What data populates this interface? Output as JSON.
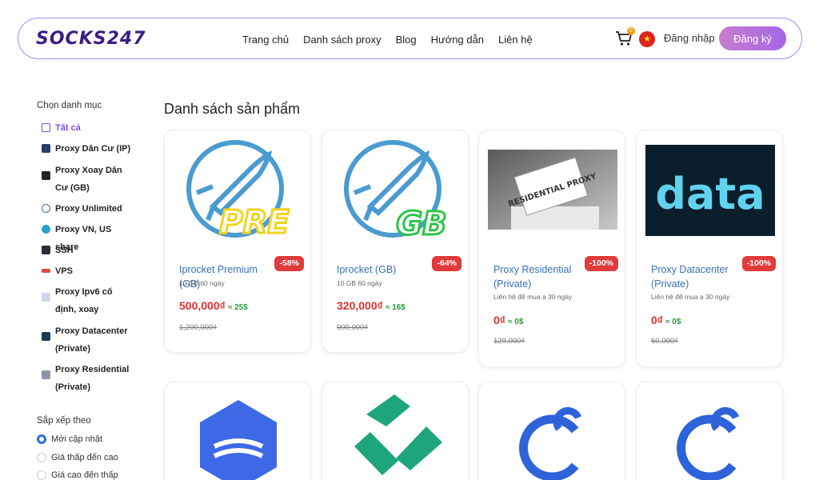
{
  "header": {
    "logo": "SOCKS247",
    "nav": [
      "Trang chủ",
      "Danh sách proxy",
      "Blog",
      "Hướng dẫn",
      "Liên hệ"
    ],
    "cart_count": "0",
    "login": "Đăng nhập",
    "register": "Đăng ký"
  },
  "sidebar": {
    "title": "Chọn danh mục",
    "items": [
      {
        "label": "Tất cả"
      },
      {
        "label": "Proxy Dân Cư (IP)"
      },
      {
        "label": "Proxy Xoay Dân Cư (GB)"
      },
      {
        "label": "Proxy Unlimited"
      },
      {
        "label": "Proxy VN, US share"
      },
      {
        "label": "SSH"
      },
      {
        "label": "VPS"
      },
      {
        "label": "Proxy Ipv6 cố định, xoay"
      },
      {
        "label": "Proxy Datacenter (Private)"
      },
      {
        "label": "Proxy Residential (Private)"
      }
    ],
    "sort_title": "Sắp xếp theo",
    "sort_options": [
      "Mới cập nhật",
      "Giá thấp đến cao",
      "Giá cao đến thấp"
    ]
  },
  "main": {
    "title": "Danh sách sản phẩm",
    "products": [
      {
        "name": "Iprocket Premium (GB)",
        "desc": "10 GB 60 ngày",
        "price": "500,000₫",
        "usd": "≈ 25$",
        "old": "1,200,000₫",
        "discount": "-58%",
        "image_text": "PRE"
      },
      {
        "name": "Iprocket (GB)",
        "desc": "10 GB 60 ngày",
        "price": "320,000₫",
        "usd": "≈ 16$",
        "old": "900,000₫",
        "discount": "-64%",
        "image_text": "GB"
      },
      {
        "name": "Proxy Residential (Private)",
        "desc": "Liên hệ để mua ạ 30 ngày",
        "price": "0₫",
        "usd": "≈ 0$",
        "old": "129,000₫",
        "discount": "-100%",
        "image_text": "RESIDENTIAL PROXY"
      },
      {
        "name": "Proxy Datacenter (Private)",
        "desc": "Liên hệ để mua ạ 30 ngày",
        "price": "0₫",
        "usd": "≈ 0$",
        "old": "60,000₫",
        "discount": "-100%",
        "image_text": "data"
      }
    ]
  },
  "colors": {
    "accent": "#7b4fe0",
    "discount": "#e03a3a",
    "price": "#e0302f",
    "usd": "#2e9a3b",
    "link": "#3a6db5"
  }
}
